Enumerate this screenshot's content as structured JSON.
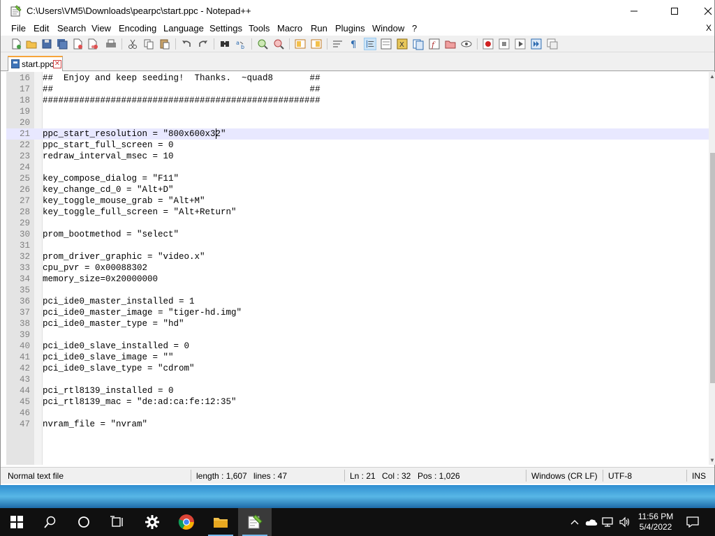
{
  "window": {
    "title": "C:\\Users\\VM5\\Downloads\\pearpc\\start.ppc - Notepad++",
    "minimize_label": "—",
    "maximize_label": "☐",
    "close_label": "✕"
  },
  "menu": {
    "items": [
      "File",
      "Edit",
      "Search",
      "View",
      "Encoding",
      "Language",
      "Settings",
      "Tools",
      "Macro",
      "Run",
      "Plugins",
      "Window",
      "?"
    ],
    "close_doc": "X"
  },
  "toolbar": {
    "icons": [
      "new-file-icon",
      "open-file-icon",
      "save-icon",
      "save-all-icon",
      "close-icon",
      "close-all-icon",
      "print-icon",
      "cut-icon",
      "copy-icon",
      "paste-icon",
      "undo-icon",
      "redo-icon",
      "find-icon",
      "replace-icon",
      "zoom-in-icon",
      "zoom-out-icon",
      "sync-vertical-icon",
      "sync-horizontal-icon",
      "word-wrap-icon",
      "show-all-chars-icon",
      "indent-guide-icon",
      "udl-icon",
      "doc-map-icon",
      "function-list-icon",
      "folder-as-workspace-icon",
      "monitoring-icon",
      "record-macro-icon",
      "stop-macro-icon",
      "play-macro-icon",
      "run-macro-multiple-icon",
      "save-macro-icon"
    ]
  },
  "tabs": [
    {
      "label": "start.ppc",
      "close": "✕",
      "active": true
    }
  ],
  "editor": {
    "current_line": 21,
    "lines": [
      {
        "n": "16",
        "text": "##  Enjoy and keep seeding!  Thanks.  ~quad8       ##"
      },
      {
        "n": "17",
        "text": "##                                                 ##"
      },
      {
        "n": "18",
        "text": "#####################################################"
      },
      {
        "n": "19",
        "text": ""
      },
      {
        "n": "20",
        "text": ""
      },
      {
        "n": "21",
        "text": "ppc_start_resolution = \"800x600x32\""
      },
      {
        "n": "22",
        "text": "ppc_start_full_screen = 0"
      },
      {
        "n": "23",
        "text": "redraw_interval_msec = 10"
      },
      {
        "n": "24",
        "text": ""
      },
      {
        "n": "25",
        "text": "key_compose_dialog = \"F11\""
      },
      {
        "n": "26",
        "text": "key_change_cd_0 = \"Alt+D\""
      },
      {
        "n": "27",
        "text": "key_toggle_mouse_grab = \"Alt+M\""
      },
      {
        "n": "28",
        "text": "key_toggle_full_screen = \"Alt+Return\""
      },
      {
        "n": "29",
        "text": ""
      },
      {
        "n": "30",
        "text": "prom_bootmethod = \"select\""
      },
      {
        "n": "31",
        "text": ""
      },
      {
        "n": "32",
        "text": "prom_driver_graphic = \"video.x\""
      },
      {
        "n": "33",
        "text": "cpu_pvr = 0x00088302"
      },
      {
        "n": "34",
        "text": "memory_size=0x20000000"
      },
      {
        "n": "35",
        "text": ""
      },
      {
        "n": "36",
        "text": "pci_ide0_master_installed = 1"
      },
      {
        "n": "37",
        "text": "pci_ide0_master_image = \"tiger-hd.img\""
      },
      {
        "n": "38",
        "text": "pci_ide0_master_type = \"hd\""
      },
      {
        "n": "39",
        "text": ""
      },
      {
        "n": "40",
        "text": "pci_ide0_slave_installed = 0"
      },
      {
        "n": "41",
        "text": "pci_ide0_slave_image = \"\""
      },
      {
        "n": "42",
        "text": "pci_ide0_slave_type = \"cdrom\""
      },
      {
        "n": "43",
        "text": ""
      },
      {
        "n": "44",
        "text": "pci_rtl8139_installed = 0"
      },
      {
        "n": "45",
        "text": "pci_rtl8139_mac = \"de:ad:ca:fe:12:35\""
      },
      {
        "n": "46",
        "text": ""
      },
      {
        "n": "47",
        "text": "nvram_file = \"nvram\""
      }
    ]
  },
  "status": {
    "file_type": "Normal text file",
    "length": "length : 1,607",
    "lines": "lines : 47",
    "ln": "Ln : 21",
    "col": "Col : 32",
    "pos": "Pos : 1,026",
    "eol": "Windows (CR LF)",
    "encoding": "UTF-8",
    "mode": "INS"
  },
  "taskbar": {
    "time": "11:56 PM",
    "date": "5/4/2022",
    "apps": [
      "start-icon",
      "search-icon",
      "cortana-icon",
      "task-view-icon",
      "settings-icon",
      "chrome-icon",
      "file-explorer-icon",
      "notepadpp-icon"
    ]
  },
  "colors": {
    "current_line_highlight": "#e8e8ff",
    "taskbar": "#101010",
    "accent": "#76b9ed"
  }
}
